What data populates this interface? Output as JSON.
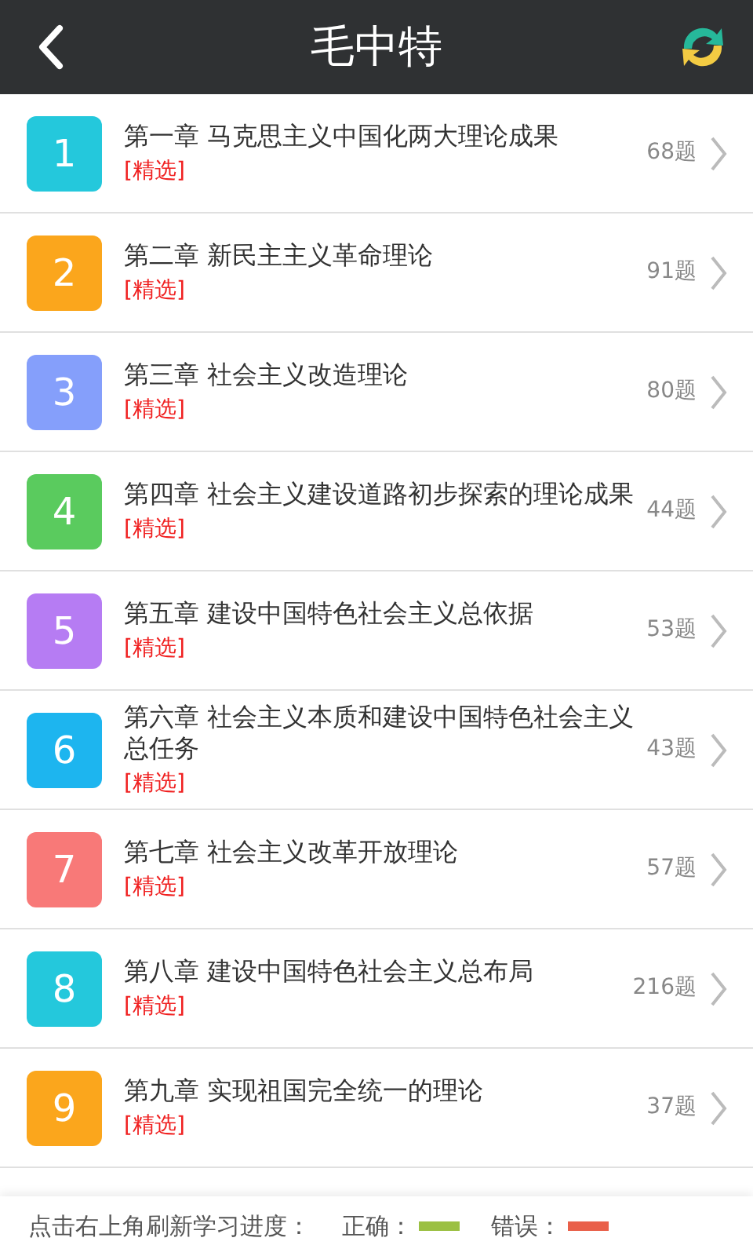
{
  "header": {
    "title": "毛中特"
  },
  "chapters": [
    {
      "number": "1",
      "color": "#24c8dc",
      "title": "第一章 马克思主义中国化两大理论成果",
      "tag": "[精选]",
      "count": "68题"
    },
    {
      "number": "2",
      "color": "#fba61c",
      "title": "第二章 新民主主义革命理论",
      "tag": "[精选]",
      "count": "91题"
    },
    {
      "number": "3",
      "color": "#859ffb",
      "title": "第三章 社会主义改造理论",
      "tag": "[精选]",
      "count": "80题"
    },
    {
      "number": "4",
      "color": "#5acb5e",
      "title": "第四章 社会主义建设道路初步探索的理论成果",
      "tag": "[精选]",
      "count": "44题"
    },
    {
      "number": "5",
      "color": "#b67cf3",
      "title": "第五章 建设中国特色社会主义总依据",
      "tag": "[精选]",
      "count": "53题"
    },
    {
      "number": "6",
      "color": "#1db5ef",
      "title": "第六章 社会主义本质和建设中国特色社会主义总任务",
      "tag": "[精选]",
      "count": "43题"
    },
    {
      "number": "7",
      "color": "#f87978",
      "title": "第七章 社会主义改革开放理论",
      "tag": "[精选]",
      "count": "57题"
    },
    {
      "number": "8",
      "color": "#24c8dc",
      "title": "第八章 建设中国特色社会主义总布局",
      "tag": "[精选]",
      "count": "216题"
    },
    {
      "number": "9",
      "color": "#fba61c",
      "title": "第九章 实现祖国完全统一的理论",
      "tag": "[精选]",
      "count": "37题"
    }
  ],
  "footer": {
    "hint": "点击右上角刷新学习进度：",
    "correct_label": "正确：",
    "wrong_label": "错误："
  }
}
